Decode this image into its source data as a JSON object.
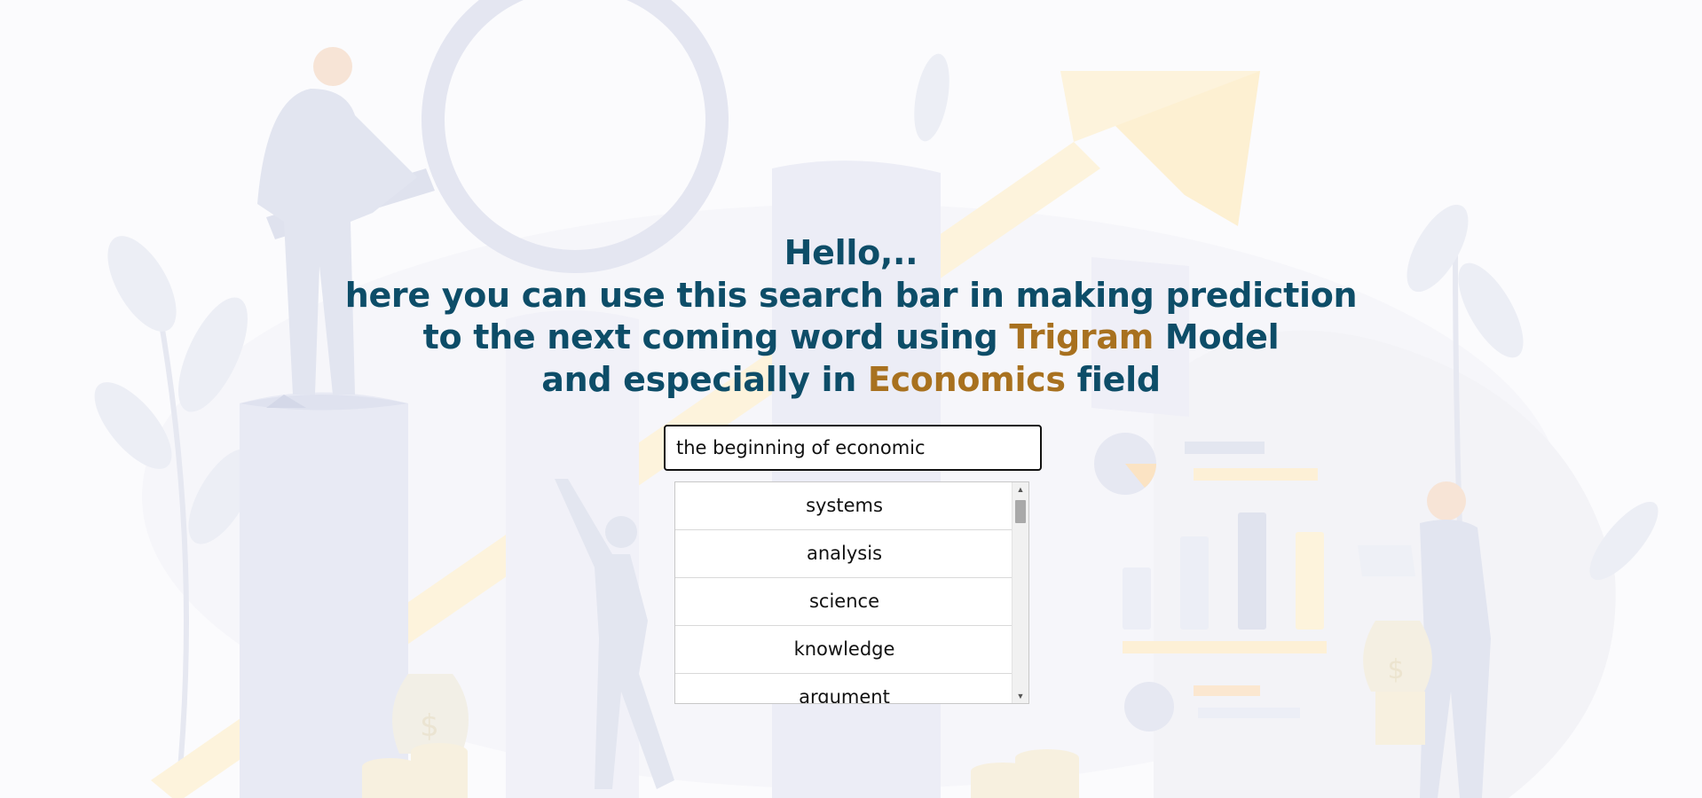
{
  "header": {
    "greeting": "Hello,..",
    "line2": "here you can use this search bar in making prediction",
    "line3_prefix": "to the next coming word using ",
    "line3_highlight": "Trigram",
    "line3_suffix": " Model",
    "line4_prefix": "and especially in ",
    "line4_highlight": "Economics",
    "line4_suffix": " field"
  },
  "search": {
    "value": "the beginning of economic"
  },
  "suggestions": [
    "systems",
    "analysis",
    "science",
    "knowledge",
    "argument"
  ],
  "scrollbar": {
    "up_glyph": "▲",
    "down_glyph": "▼"
  },
  "colors": {
    "title": "#0d4d68",
    "highlight": "#a8711f",
    "illustration_blue": "#e6e8f3",
    "illustration_yellow": "#fdf3dc"
  },
  "icons": [
    "magnifier-illustration",
    "growth-arrow-illustration",
    "money-bag-icon",
    "coin-stack-icon",
    "pie-chart-icon",
    "bar-chart-icon"
  ]
}
